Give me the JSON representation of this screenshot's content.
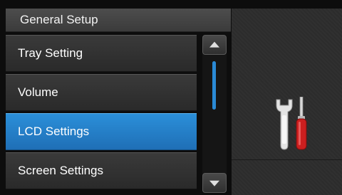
{
  "header": {
    "title": "General Setup"
  },
  "menu": {
    "items": [
      {
        "label": "Tray Setting",
        "selected": false
      },
      {
        "label": "Volume",
        "selected": false
      },
      {
        "label": "LCD Settings",
        "selected": true
      },
      {
        "label": "Screen Settings",
        "selected": false
      }
    ]
  },
  "scrollbar": {
    "up_icon": "triangle-up",
    "down_icon": "triangle-down"
  },
  "icons": {
    "settings": "wrench-screwdriver"
  },
  "colors": {
    "selected": "#2483cf",
    "scroll_thumb": "#2a8ad6",
    "screwdriver_handle": "#cc1f1f"
  }
}
